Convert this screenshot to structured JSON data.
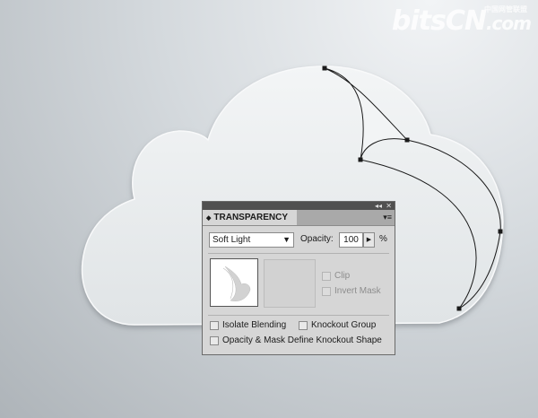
{
  "watermark": {
    "brand": "bitsCN",
    "domain": ".com",
    "small": "中国网管联盟"
  },
  "panel": {
    "title": "TRANSPARENCY",
    "arrows": "◆",
    "menu": "▾≡",
    "collapse": "◂◂",
    "close": "✕",
    "blend_mode": "Soft Light",
    "opacity_label": "Opacity:",
    "opacity_value": "100",
    "opacity_unit": "%",
    "clip_label": "Clip",
    "invert_mask_label": "Invert Mask",
    "isolate_blending_label": "Isolate Blending",
    "knockout_group_label": "Knockout Group",
    "opacity_mask_label": "Opacity & Mask Define Knockout Shape"
  },
  "colors": {
    "panel_bg": "#d6d6d6",
    "titlebar": "#505050",
    "cloud": "#e9ecee"
  }
}
